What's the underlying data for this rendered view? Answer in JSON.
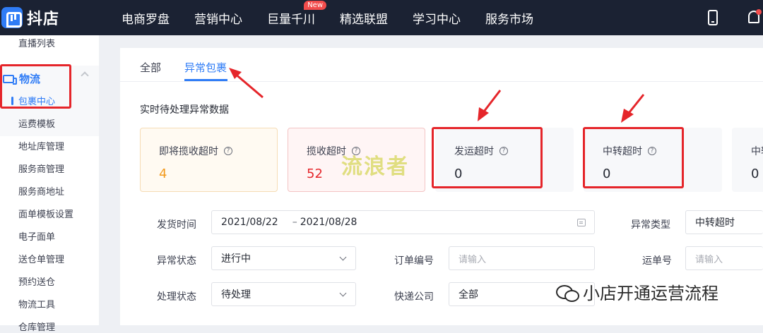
{
  "topbar": {
    "logo_text": "抖店",
    "nav": [
      "电商罗盘",
      "营销中心",
      "巨量千川",
      "精选联盟",
      "学习中心",
      "服务市场"
    ],
    "new_badge": "New"
  },
  "sidebar": {
    "top_item": "直播列表",
    "group_label": "物流",
    "active_item": "包裹中心",
    "items": [
      "运费模板",
      "地址库管理",
      "服务商管理",
      "服务商地址",
      "面单模板设置",
      "电子面单",
      "送仓单管理",
      "预约送仓",
      "物流工具",
      "仓库管理"
    ]
  },
  "tabs": {
    "all": "全部",
    "abnormal": "异常包裹"
  },
  "section_title": "实时待处理异常数据",
  "cards": [
    {
      "title": "即将揽收超时",
      "value": "4",
      "value_color": "#f29a1e",
      "bg": "#fffaf2",
      "border": "#f6dcb5"
    },
    {
      "title": "揽收超时",
      "value": "52",
      "value_color": "#e5252a",
      "bg": "#fff5f5",
      "border": "#f3c4c4"
    },
    {
      "title": "发运超时",
      "value": "0",
      "value_color": "#252933",
      "bg": "#f7f8fa",
      "border": "#f7f8fa"
    },
    {
      "title": "中转超时",
      "value": "0",
      "value_color": "#252933",
      "bg": "#f7f8fa",
      "border": "#f7f8fa"
    },
    {
      "title": "中转",
      "value": "0",
      "value_color": "#252933",
      "bg": "#f7f8fa",
      "border": "#f7f8fa"
    }
  ],
  "watermark": "流浪者",
  "filters": {
    "ship_time_label": "发货时间",
    "date_start": "2021/08/22",
    "date_sep": "–",
    "date_end": "2021/08/28",
    "abnormal_type_label": "异常类型",
    "abnormal_type_value": "中转超时",
    "abnormal_status_label": "异常状态",
    "abnormal_status_value": "进行中",
    "order_no_label": "订单编号",
    "order_no_placeholder": "请输入",
    "waybill_label": "运单号",
    "waybill_placeholder": "请输入",
    "process_status_label": "处理状态",
    "process_status_value": "待处理",
    "courier_label": "快递公司",
    "courier_value": "全部"
  },
  "footer_watermark": "小店开通运营流程",
  "accent_color": "#2f7cf6",
  "annotation_color": "#e5252a"
}
